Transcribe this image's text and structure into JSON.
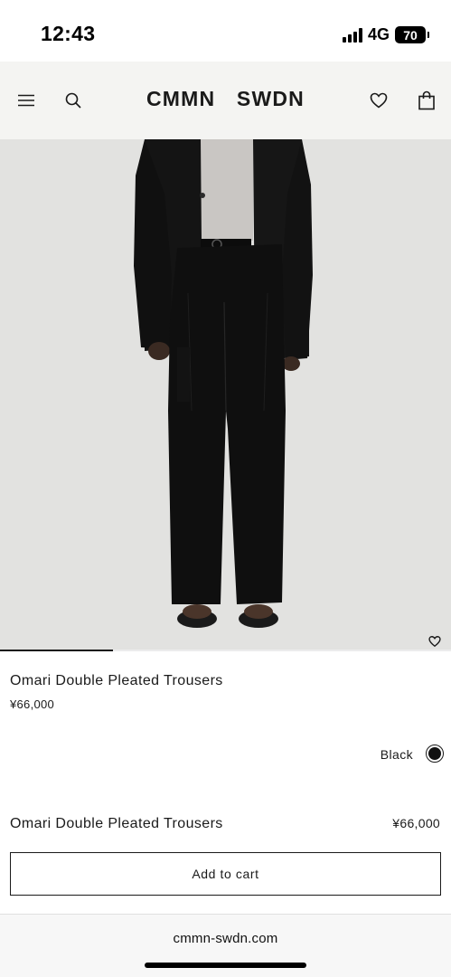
{
  "status_bar": {
    "time": "12:43",
    "network": "4G",
    "battery": "70"
  },
  "header": {
    "logo": "CMMN SWDN",
    "icons": [
      "menu-icon",
      "search-icon",
      "heart-icon",
      "bag-icon"
    ]
  },
  "gallery": {
    "progress_fraction": 0.25
  },
  "product": {
    "name": "Omari Double Pleated Trousers",
    "price": "¥66,000",
    "color_label": "Black",
    "color_swatch": "#111111"
  },
  "sticky_bar": {
    "name": "Omari Double Pleated Trousers",
    "price": "¥66,000",
    "add_to_cart_label": "Add to cart"
  },
  "browser": {
    "url": "cmmn-swdn.com"
  }
}
